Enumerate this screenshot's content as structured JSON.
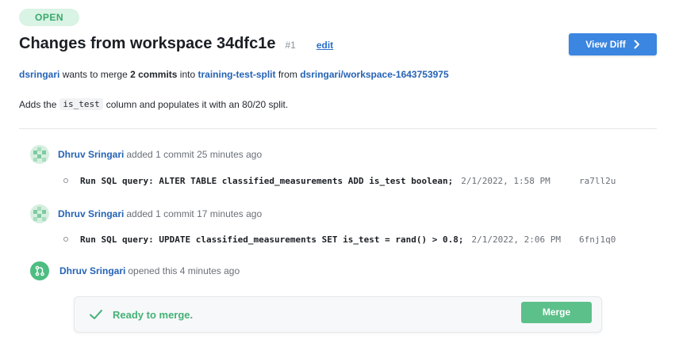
{
  "status_badge": "OPEN",
  "header": {
    "title": "Changes from workspace 34dfc1e",
    "number": "#1",
    "edit_label": "edit",
    "view_diff_label": "View Diff"
  },
  "merge_summary": {
    "user": "dsringari",
    "text1": "wants to merge",
    "commit_count": "2 commits",
    "text2": "into",
    "target_branch": "training-test-split",
    "text3": "from",
    "source_branch": "dsringari/workspace-1643753975"
  },
  "description": {
    "before": "Adds the",
    "code": "is_test",
    "after": "column and populates it with an 80/20 split."
  },
  "timeline": [
    {
      "author": "Dhruv Sringari",
      "action": "added 1 commit 25 minutes ago",
      "commit": {
        "message": "Run SQL query: ALTER TABLE classified_measurements ADD is_test boolean;",
        "time": "2/1/2022, 1:58 PM",
        "sha": "ra7ll2u"
      }
    },
    {
      "author": "Dhruv Sringari",
      "action": "added 1 commit 17 minutes ago",
      "commit": {
        "message": "Run SQL query: UPDATE classified_measurements SET is_test = rand() > 0.8;",
        "time": "2/1/2022, 2:06 PM",
        "sha": "6fnj1q0"
      }
    },
    {
      "author": "Dhruv Sringari",
      "action": "opened this 4 minutes ago"
    }
  ],
  "merge_box": {
    "status_text": "Ready to merge.",
    "button_label": "Merge"
  },
  "colors": {
    "accent_blue": "#3b86e0",
    "link_blue": "#2563b6",
    "success_green": "#43b276",
    "merge_button_green": "#5cc08a"
  }
}
